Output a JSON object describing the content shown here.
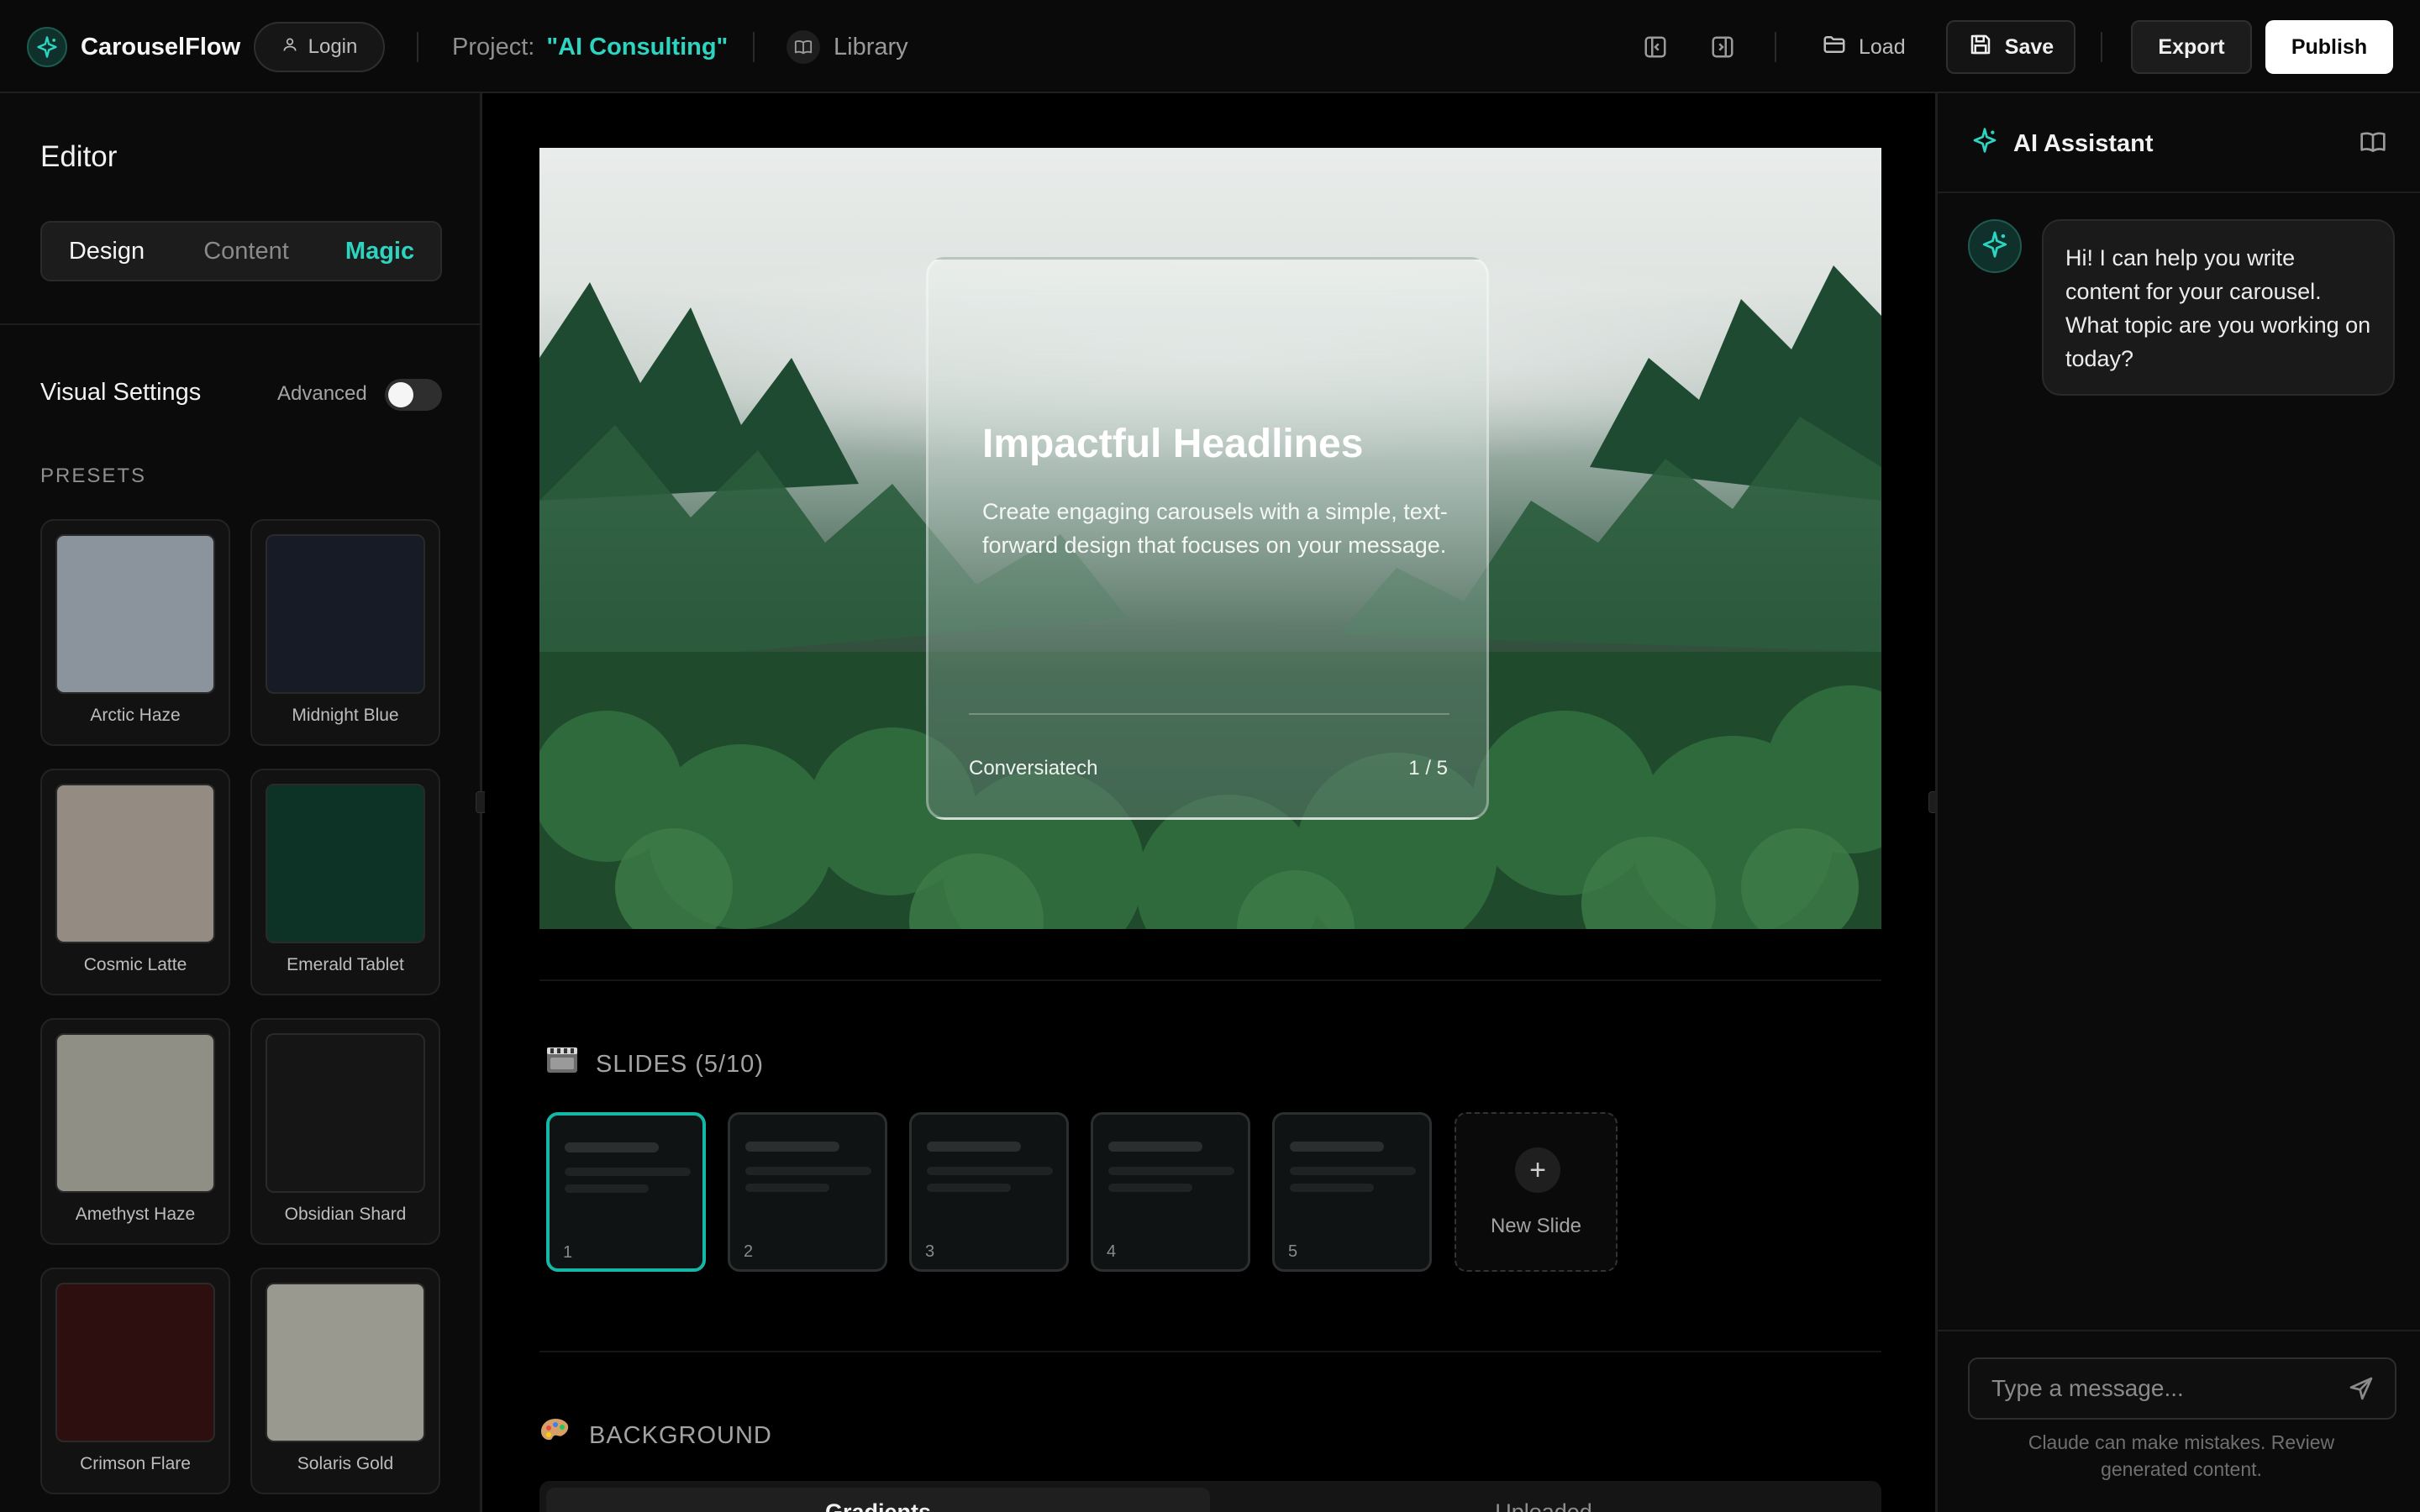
{
  "header": {
    "app_name": "CarouselFlow",
    "login_label": "Login",
    "project_label": "Project:",
    "project_name": "\"AI Consulting\"",
    "library_label": "Library",
    "load_label": "Load",
    "save_label": "Save",
    "export_label": "Export",
    "publish_label": "Publish"
  },
  "sidebar": {
    "title": "Editor",
    "tabs": [
      "Design",
      "Content",
      "Magic"
    ],
    "active_tab": "Magic",
    "visual_settings_label": "Visual Settings",
    "advanced_label": "Advanced",
    "advanced_enabled": false,
    "presets_label": "PRESETS",
    "presets": [
      {
        "name": "Arctic Haze",
        "color": "#8b949c"
      },
      {
        "name": "Midnight Blue",
        "color": "#161b26"
      },
      {
        "name": "Cosmic Latte",
        "color": "#948c83"
      },
      {
        "name": "Emerald Tablet",
        "color": "#0d3226"
      },
      {
        "name": "Amethyst Haze",
        "color": "#8f8f85"
      },
      {
        "name": "Obsidian Shard",
        "color": "#151515"
      },
      {
        "name": "Crimson Flare",
        "color": "#2e0f10"
      },
      {
        "name": "Solaris Gold",
        "color": "#9a9990"
      }
    ]
  },
  "canvas": {
    "headline": "Impactful Headlines",
    "body": "Create engaging carousels with a simple, text-forward design that focuses on your message.",
    "brand": "Conversiatech",
    "page_indicator": "1 / 5"
  },
  "slides": {
    "heading": "SLIDES (5/10)",
    "items": [
      "1",
      "2",
      "3",
      "4",
      "5"
    ],
    "active_index": 0,
    "new_slide_label": "New Slide",
    "accent_color": "#14b8a6"
  },
  "background": {
    "heading": "BACKGROUND",
    "tabs": [
      "Gradients",
      "Uploaded"
    ]
  },
  "assistant": {
    "title": "AI Assistant",
    "message": "Hi! I can help you write content for your carousel. What topic are you working on today?",
    "input_placeholder": "Type a message...",
    "disclaimer": "Claude can make mistakes. Review generated content."
  },
  "icons": {
    "logo": "sparkle-icon",
    "login": "user-icon",
    "library": "book-open-icon",
    "left_panel": "panel-left-icon",
    "right_panel": "panel-right-icon",
    "load": "folder-open-icon",
    "save": "save-icon",
    "slides": "film-slides-icon",
    "background": "palette-icon",
    "send": "send-icon"
  }
}
